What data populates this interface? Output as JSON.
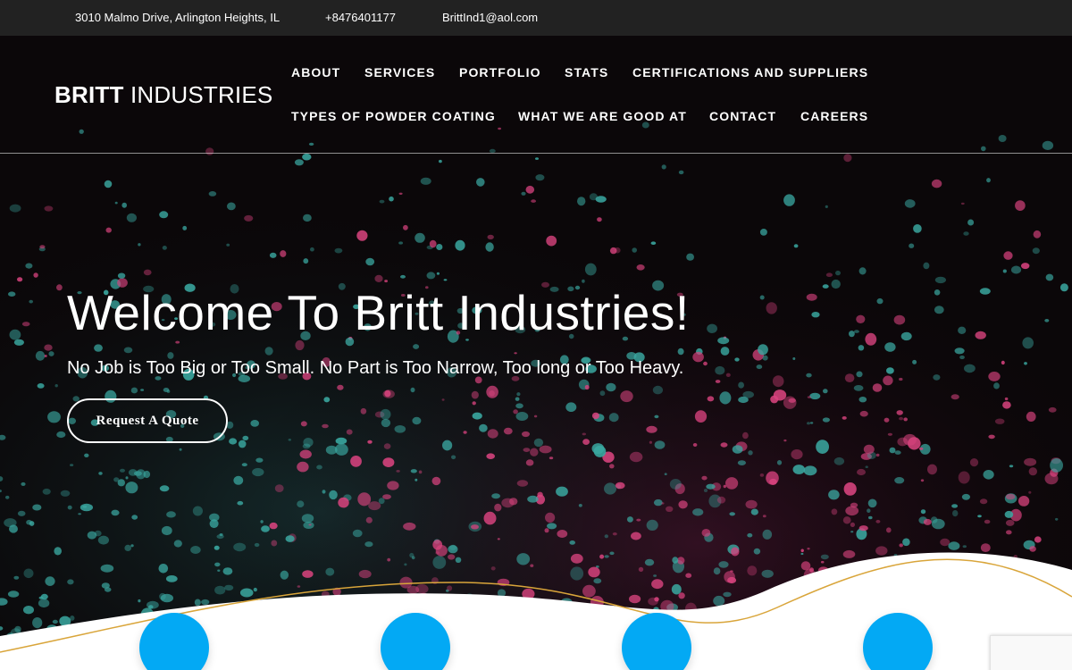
{
  "topbar": {
    "address": "3010 Malmo Drive, Arlington Heights, IL",
    "phone": "+8476401177",
    "email": "BrittInd1@aol.com"
  },
  "brand": {
    "bold": "BRITT",
    "light": "INDUSTRIES"
  },
  "nav": [
    "ABOUT",
    "SERVICES",
    "PORTFOLIO",
    "STATS",
    "CERTIFICATIONS AND SUPPLIERS",
    "TYPES OF POWDER COATING",
    "WHAT WE ARE GOOD AT",
    "CONTACT",
    "CAREERS"
  ],
  "hero": {
    "title": "Welcome To Britt Industries!",
    "subtitle": "No Job is Too Big or Too Small. No Part is Too Narrow, Too long or Too Heavy.",
    "cta": "Request A Quote"
  },
  "colors": {
    "topbar_bg": "#222222",
    "accent_blue": "#03a9f4",
    "wave_line": "#d9a53a",
    "particle_teal": "#3aa7a0",
    "particle_pink": "#d8437e"
  }
}
